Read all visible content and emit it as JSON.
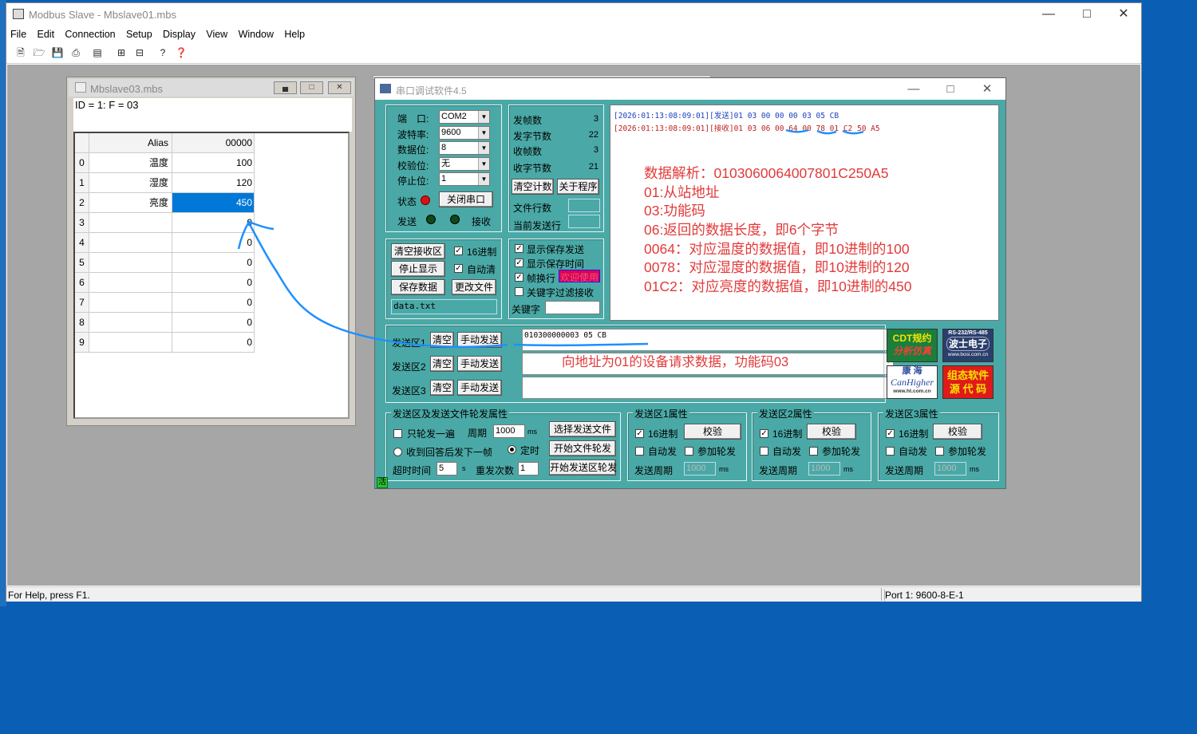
{
  "main_window": {
    "title": "Modbus Slave - Mbslave01.mbs",
    "menu": [
      "File",
      "Edit",
      "Connection",
      "Setup",
      "Display",
      "View",
      "Window",
      "Help"
    ],
    "status_left": "For Help, press F1.",
    "status_right": "Port 1: 9600-8-E-1"
  },
  "child_window": {
    "title": "Mbslave03.mbs",
    "header": "ID = 1: F = 03",
    "columns": [
      "Alias",
      "00000"
    ],
    "rows": [
      {
        "idx": "0",
        "alias": "温度",
        "value": "100"
      },
      {
        "idx": "1",
        "alias": "湿度",
        "value": "120"
      },
      {
        "idx": "2",
        "alias": "亮度",
        "value": "450"
      },
      {
        "idx": "3",
        "alias": "",
        "value": "0"
      },
      {
        "idx": "4",
        "alias": "",
        "value": "0"
      },
      {
        "idx": "5",
        "alias": "",
        "value": "0"
      },
      {
        "idx": "6",
        "alias": "",
        "value": "0"
      },
      {
        "idx": "7",
        "alias": "",
        "value": "0"
      },
      {
        "idx": "8",
        "alias": "",
        "value": "0"
      },
      {
        "idx": "9",
        "alias": "",
        "value": "0"
      }
    ],
    "selected_row": "2"
  },
  "serial_tool": {
    "title": "串口调试软件4.5",
    "settings": {
      "port_label": "端　口:",
      "port": "COM2",
      "baud_label": "波特率:",
      "baud": "9600",
      "data_label": "数据位:",
      "data": "8",
      "parity_label": "校验位:",
      "parity": "无",
      "stop_label": "停止位:",
      "stop": "1",
      "state_label": "状态",
      "close_button": "关闭串口",
      "send_label": "发送",
      "recv_label": "接收"
    },
    "counters": {
      "sent_frames_label": "发帧数",
      "sent_frames": "3",
      "sent_bytes_label": "发字节数",
      "sent_bytes": "22",
      "recv_frames_label": "收帧数",
      "recv_frames": "3",
      "recv_bytes_label": "收字节数",
      "recv_bytes": "21",
      "clear_count": "清空计数",
      "about": "关于程序",
      "file_lines_label": "文件行数",
      "current_line_label": "当前发送行"
    },
    "recv_controls": {
      "clear_recv": "清空接收区",
      "hex": "16进制",
      "stop_display": "停止显示",
      "auto_clear": "自动清",
      "save_data": "保存数据",
      "change_file": "更改文件",
      "filename": "data.txt"
    },
    "display_opts": {
      "show_save_send": "显示保存发送",
      "show_save_time": "显示保存时间",
      "frame_newline": "帧换行",
      "welcome": "欢迎使用",
      "keyword_filter": "关键字过滤接收",
      "keyword_label": "关键字"
    },
    "recv_lines": [
      {
        "ts": "[2026:01:13:08:09:01]",
        "tag": "[发送]",
        "data": "01 03 00 00 00 03 05 CB"
      },
      {
        "ts": "[2026:01:13:08:09:01]",
        "tag": "[接收]",
        "data": "01 03 06 00 64 00 78 01 C2 50 A5"
      }
    ],
    "notes": [
      "数据解析：0103060064007801C250A5",
      "01:从站地址",
      "03:功能码",
      "06:返回的数据长度，即6个字节",
      "0064：对应温度的数据值，即10进制的100",
      "0078：对应湿度的数据值，即10进制的120",
      "01C2：对应亮度的数据值，即10进制的450"
    ],
    "send_areas": [
      {
        "label": "发送区1",
        "clear": "清空",
        "send": "手动发送",
        "content": "010300000003 05 CB"
      },
      {
        "label": "发送区2",
        "clear": "清空",
        "send": "手动发送",
        "content": ""
      },
      {
        "label": "发送区3",
        "clear": "清空",
        "send": "手动发送",
        "content": ""
      }
    ],
    "send_annotation": "向地址为01的设备请求数据，功能码03",
    "ads": {
      "cdt_line1": "CDT规约",
      "cdt_line2": "分析仿真",
      "bosi_top": "RS-232/RS-485",
      "bosi_main": "波士电子",
      "bosi_url": "www.bosi.com.cn",
      "kh_line1": "康 海",
      "kh_line2": "CanHigher",
      "kh_url": "www.ht.com.cn",
      "cfg_line1": "组态软件",
      "cfg_line2": "源 代 码"
    },
    "cycle_group": {
      "title": "发送区及发送文件轮发属性",
      "once": "只轮发一遍",
      "period_label": "周期",
      "period": "1000",
      "ms": "ms",
      "select_file": "选择发送文件",
      "after_reply": "收到回答后发下一帧",
      "timed": "定时",
      "start_file": "开始文件轮发",
      "timeout_label": "超时时间",
      "timeout": "5",
      "s": "s",
      "retry_label": "重发次数",
      "retry": "1",
      "start_area": "开始发送区轮发"
    },
    "area_props": [
      {
        "title": "发送区1属性",
        "hex": "16进制",
        "check": "校验",
        "auto": "自动发",
        "join": "参加轮发",
        "period_label": "发送周期",
        "period": "1000",
        "ms": "ms"
      },
      {
        "title": "发送区2属性",
        "hex": "16进制",
        "check": "校验",
        "auto": "自动发",
        "join": "参加轮发",
        "period_label": "发送周期",
        "period": "1000",
        "ms": "ms"
      },
      {
        "title": "发送区3属性",
        "hex": "16进制",
        "check": "校验",
        "auto": "自动发",
        "join": "参加轮发",
        "period_label": "发送周期",
        "period": "1000",
        "ms": "ms"
      }
    ],
    "corner_mark": "活"
  },
  "colors": {
    "accent_note": "#e23a3a",
    "serial_bg": "#4aa9a6",
    "desktop": "#0a5fb4",
    "selection": "#0078d7",
    "annotation_pen": "#1e90ff"
  }
}
